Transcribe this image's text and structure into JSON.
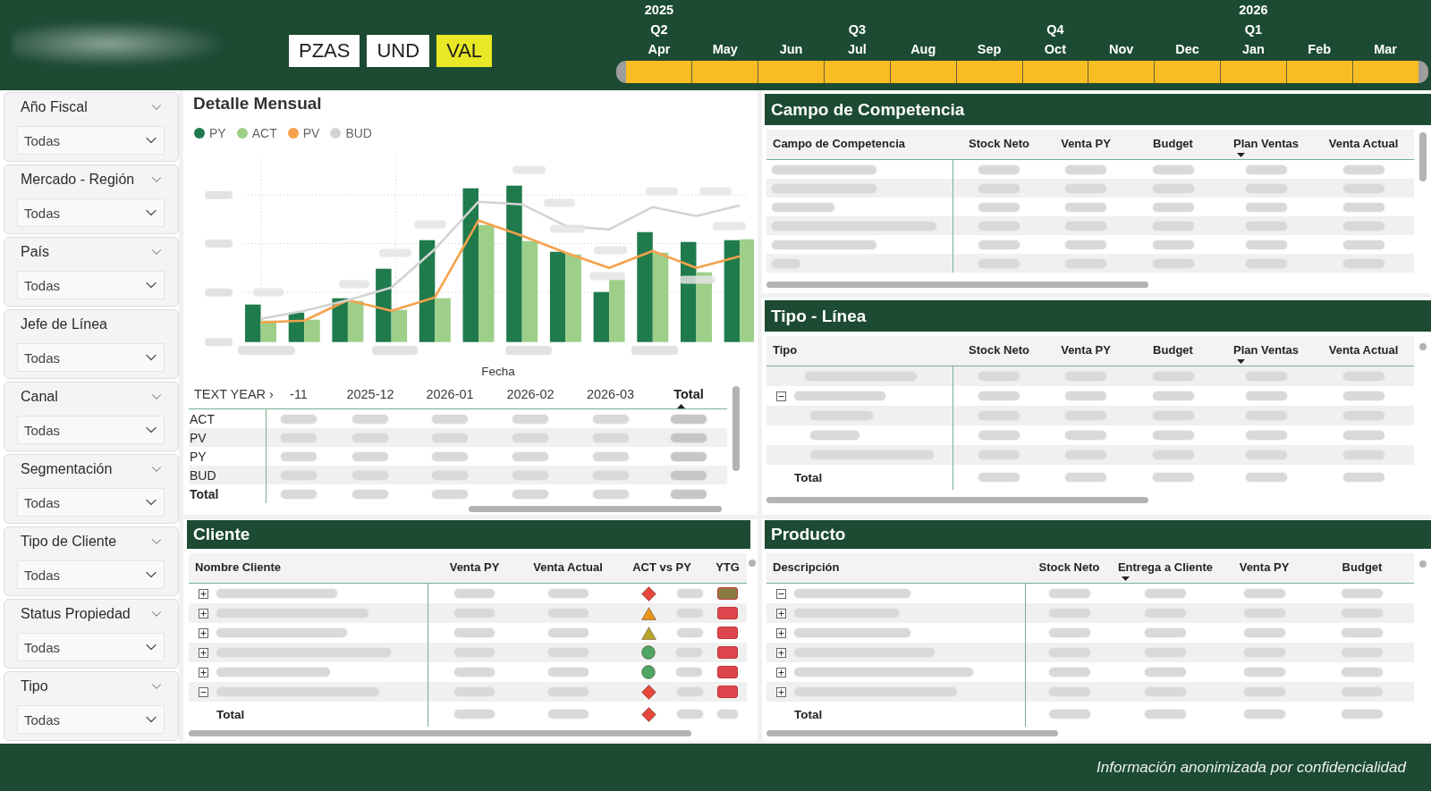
{
  "unit_toggle": [
    {
      "label": "PZAS",
      "selected": false
    },
    {
      "label": "UND",
      "selected": false
    },
    {
      "label": "VAL",
      "selected": true
    }
  ],
  "timeline": {
    "months": [
      {
        "label": "Apr",
        "quarter": "Q2",
        "year": "2025",
        "selected": true
      },
      {
        "label": "May",
        "selected": true
      },
      {
        "label": "Jun",
        "selected": true
      },
      {
        "label": "Jul",
        "quarter": "Q3",
        "selected": true
      },
      {
        "label": "Aug",
        "selected": true
      },
      {
        "label": "Sep",
        "selected": true
      },
      {
        "label": "Oct",
        "quarter": "Q4",
        "selected": true
      },
      {
        "label": "Nov",
        "selected": true
      },
      {
        "label": "Dec",
        "selected": true
      },
      {
        "label": "Jan",
        "quarter": "Q1",
        "year": "2026",
        "selected": true
      },
      {
        "label": "Feb",
        "selected": true
      },
      {
        "label": "Mar",
        "selected": true
      }
    ]
  },
  "filters": [
    {
      "label": "Año Fiscal",
      "value": "Todas",
      "collapsible": true
    },
    {
      "label": "Mercado - Región",
      "value": "Todas",
      "collapsible": true
    },
    {
      "label": "País",
      "value": "Todas",
      "collapsible": true
    },
    {
      "label": "Jefe de Línea",
      "value": "Todas",
      "collapsible": false
    },
    {
      "label": "Canal",
      "value": "Todas",
      "collapsible": true
    },
    {
      "label": "Segmentación",
      "value": "Todas",
      "collapsible": true
    },
    {
      "label": "Tipo de Cliente",
      "value": "Todas",
      "collapsible": true
    },
    {
      "label": "Status Propiedad",
      "value": "Todas",
      "collapsible": true
    },
    {
      "label": "Tipo",
      "value": "Todas",
      "collapsible": true
    }
  ],
  "monthly_detail": {
    "title": "Detalle Mensual",
    "legend": [
      {
        "label": "PY",
        "color": "#1f7a4c",
        "kind": "bar"
      },
      {
        "label": "ACT",
        "color": "#9dcf89",
        "kind": "bar"
      },
      {
        "label": "PV",
        "color": "#f5a14c",
        "kind": "line"
      },
      {
        "label": "BUD",
        "color": "#d3d3d3",
        "kind": "line"
      }
    ],
    "xlabel": "Fecha",
    "matrix": {
      "columns": [
        {
          "label": "TEXT YEAR ›",
          "kind": "rows",
          "sorted": false
        },
        {
          "label": "-11",
          "kind": "period",
          "sorted": false
        },
        {
          "label": "2025-12",
          "kind": "period",
          "sorted": false
        },
        {
          "label": "2026-01",
          "kind": "period",
          "sorted": false
        },
        {
          "label": "2026-02",
          "kind": "period",
          "sorted": false
        },
        {
          "label": "2026-03",
          "kind": "period",
          "sorted": false
        },
        {
          "label": "Total",
          "kind": "total",
          "sorted": true,
          "descending": false
        }
      ],
      "rows": [
        {
          "label": "ACT",
          "kind": "measure",
          "blurred": true
        },
        {
          "label": "PV",
          "kind": "measure",
          "blurred": true
        },
        {
          "label": "PY",
          "kind": "measure",
          "blurred": true
        },
        {
          "label": "BUD",
          "kind": "measure",
          "blurred": true
        },
        {
          "label": "Total",
          "kind": "total",
          "blurred": true
        }
      ]
    }
  },
  "campo_competencia": {
    "title": "Campo de Competencia",
    "columns": [
      {
        "label": "Campo de Competencia",
        "sorted": false
      },
      {
        "label": "Stock Neto",
        "sorted": false
      },
      {
        "label": "Venta PY",
        "sorted": false
      },
      {
        "label": "Budget",
        "sorted": false
      },
      {
        "label": "Plan Ventas",
        "sorted": true,
        "descending": true
      },
      {
        "label": "Venta Actual",
        "sorted": false
      }
    ],
    "rows": [
      {
        "blurred": true
      },
      {
        "blurred": true
      },
      {
        "blurred": true
      },
      {
        "blurred": true
      },
      {
        "blurred": true
      },
      {
        "blurred": true
      }
    ]
  },
  "tipo_linea": {
    "title": "Tipo - Línea",
    "columns": [
      {
        "label": "Tipo",
        "sorted": false
      },
      {
        "label": "Stock Neto",
        "sorted": false
      },
      {
        "label": "Venta PY",
        "sorted": false
      },
      {
        "label": "Budget",
        "sorted": false
      },
      {
        "label": "Plan Ventas",
        "sorted": true,
        "descending": true
      },
      {
        "label": "Venta Actual",
        "sorted": false
      }
    ],
    "rows": [
      {
        "blurred": true
      },
      {
        "blurred": true,
        "expanded": true,
        "children": [
          {
            "blurred": true
          },
          {
            "blurred": true
          },
          {
            "blurred": true
          }
        ]
      }
    ],
    "total": {
      "label": "Total",
      "blurred": true
    }
  },
  "cliente": {
    "title": "Cliente",
    "columns": [
      {
        "label": "Nombre Cliente"
      },
      {
        "label": "Venta PY"
      },
      {
        "label": "Venta Actual"
      },
      {
        "label": "ACT vs PY"
      },
      {
        "label": "YTG"
      }
    ],
    "rows": [
      {
        "blurred": true,
        "expanded": false,
        "indicator": {
          "kind": "diamond",
          "color": "#e5473b"
        },
        "ytg": {
          "color": "#8c7a45"
        }
      },
      {
        "blurred": true,
        "expanded": false,
        "indicator": {
          "kind": "triangle",
          "color": "#e8941a"
        },
        "ytg": {
          "color": "#dc454c"
        }
      },
      {
        "blurred": true,
        "expanded": false,
        "indicator": {
          "kind": "triangle",
          "color": "#b9a42a"
        },
        "ytg": {
          "color": "#dc454c"
        }
      },
      {
        "blurred": true,
        "expanded": false,
        "indicator": {
          "kind": "circle",
          "color": "#4ea564"
        },
        "ytg": {
          "color": "#dc454c"
        }
      },
      {
        "blurred": true,
        "expanded": false,
        "indicator": {
          "kind": "circle",
          "color": "#4ea564"
        },
        "ytg": {
          "color": "#dc454c"
        }
      },
      {
        "blurred": true,
        "expanded": true,
        "indicator": {
          "kind": "diamond",
          "color": "#e5473b"
        },
        "ytg": {
          "color": "#dc454c"
        }
      }
    ],
    "total": {
      "label": "Total",
      "blurred": true,
      "indicator": {
        "kind": "diamond",
        "color": "#e5473b"
      }
    }
  },
  "producto": {
    "title": "Producto",
    "columns": [
      {
        "label": "Descripción",
        "sorted": false
      },
      {
        "label": "Stock Neto",
        "sorted": false
      },
      {
        "label": "Entrega a Cliente",
        "sorted": true,
        "descending": true
      },
      {
        "label": "Venta PY",
        "sorted": false
      },
      {
        "label": "Budget",
        "sorted": false
      }
    ],
    "rows": [
      {
        "blurred": true,
        "expanded": true
      },
      {
        "blurred": true,
        "expanded": false
      },
      {
        "blurred": true,
        "expanded": false
      },
      {
        "blurred": true,
        "expanded": false
      },
      {
        "blurred": true,
        "expanded": false
      },
      {
        "blurred": true,
        "expanded": false
      }
    ],
    "total": {
      "label": "Total",
      "blurred": true
    }
  },
  "footer": {
    "note": "Información anonimizada por confidencialidad"
  }
}
